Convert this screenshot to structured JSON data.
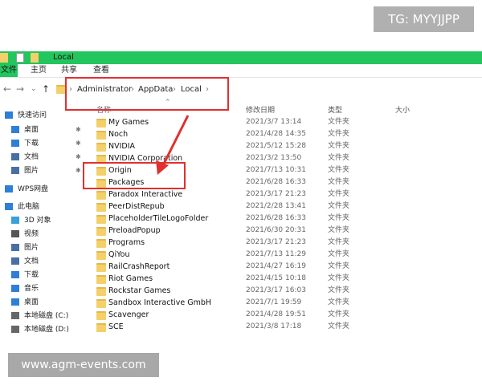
{
  "watermark_top": "TG: MYYJJPP",
  "watermark_bottom": "www.agm-events.com",
  "window": {
    "title": "Local"
  },
  "ribbon": {
    "tabs": [
      "文件",
      "主页",
      "共享",
      "查看"
    ]
  },
  "address": {
    "crumbs": [
      "Administrator",
      "AppData",
      "Local"
    ],
    "sep": "›"
  },
  "columns": {
    "name": "名称",
    "date": "修改日期",
    "type": "类型",
    "size": "大小"
  },
  "sidebar": {
    "items": [
      {
        "label": "快速访问",
        "icon": "star-icon",
        "pinned": false
      },
      {
        "label": "桌面",
        "icon": "desktop-icon",
        "pinned": true
      },
      {
        "label": "下载",
        "icon": "download-icon",
        "pinned": true
      },
      {
        "label": "文档",
        "icon": "document-icon",
        "pinned": true
      },
      {
        "label": "图片",
        "icon": "picture-icon",
        "pinned": true
      },
      {
        "label": "WPS网盘",
        "icon": "cloud-icon",
        "pinned": false
      },
      {
        "label": "此电脑",
        "icon": "computer-icon",
        "pinned": false
      },
      {
        "label": "3D 对象",
        "icon": "cube-icon",
        "pinned": false
      },
      {
        "label": "视频",
        "icon": "video-icon",
        "pinned": false
      },
      {
        "label": "图片",
        "icon": "picture-icon",
        "pinned": false
      },
      {
        "label": "文档",
        "icon": "document-icon",
        "pinned": false
      },
      {
        "label": "下载",
        "icon": "download-icon",
        "pinned": false
      },
      {
        "label": "音乐",
        "icon": "music-icon",
        "pinned": false
      },
      {
        "label": "桌面",
        "icon": "desktop-icon",
        "pinned": false
      },
      {
        "label": "本地磁盘 (C:)",
        "icon": "drive-icon",
        "pinned": false
      },
      {
        "label": "本地磁盘 (D:)",
        "icon": "drive-icon",
        "pinned": false
      }
    ]
  },
  "files": [
    {
      "name": "My Games",
      "date": "2021/3/7 13:14",
      "type": "文件夹"
    },
    {
      "name": "Noch",
      "date": "2021/4/28 14:35",
      "type": "文件夹"
    },
    {
      "name": "NVIDIA",
      "date": "2021/5/12 15:28",
      "type": "文件夹"
    },
    {
      "name": "NVIDIA Corporation",
      "date": "2021/3/2 13:50",
      "type": "文件夹"
    },
    {
      "name": "Origin",
      "date": "2021/7/13 10:31",
      "type": "文件夹"
    },
    {
      "name": "Packages",
      "date": "2021/6/28 16:33",
      "type": "文件夹"
    },
    {
      "name": "Paradox Interactive",
      "date": "2021/3/17 21:23",
      "type": "文件夹"
    },
    {
      "name": "PeerDistRepub",
      "date": "2021/2/28 13:41",
      "type": "文件夹"
    },
    {
      "name": "PlaceholderTileLogoFolder",
      "date": "2021/6/28 16:33",
      "type": "文件夹"
    },
    {
      "name": "PreloadPopup",
      "date": "2021/6/30 20:31",
      "type": "文件夹"
    },
    {
      "name": "Programs",
      "date": "2021/3/17 21:23",
      "type": "文件夹"
    },
    {
      "name": "QiYou",
      "date": "2021/7/13 11:29",
      "type": "文件夹"
    },
    {
      "name": "RailCrashReport",
      "date": "2021/4/27 16:19",
      "type": "文件夹"
    },
    {
      "name": "Riot Games",
      "date": "2021/4/15 10:18",
      "type": "文件夹"
    },
    {
      "name": "Rockstar Games",
      "date": "2021/3/17 16:03",
      "type": "文件夹"
    },
    {
      "name": "Sandbox Interactive GmbH",
      "date": "2021/7/1 19:59",
      "type": "文件夹"
    },
    {
      "name": "Scavenger",
      "date": "2021/4/28 19:51",
      "type": "文件夹"
    },
    {
      "name": "SCE",
      "date": "2021/3/8 17:18",
      "type": "文件夹"
    }
  ],
  "colors": {
    "accent": "#22c55e",
    "highlight": "#e03030",
    "folder": "#f4d06a"
  }
}
